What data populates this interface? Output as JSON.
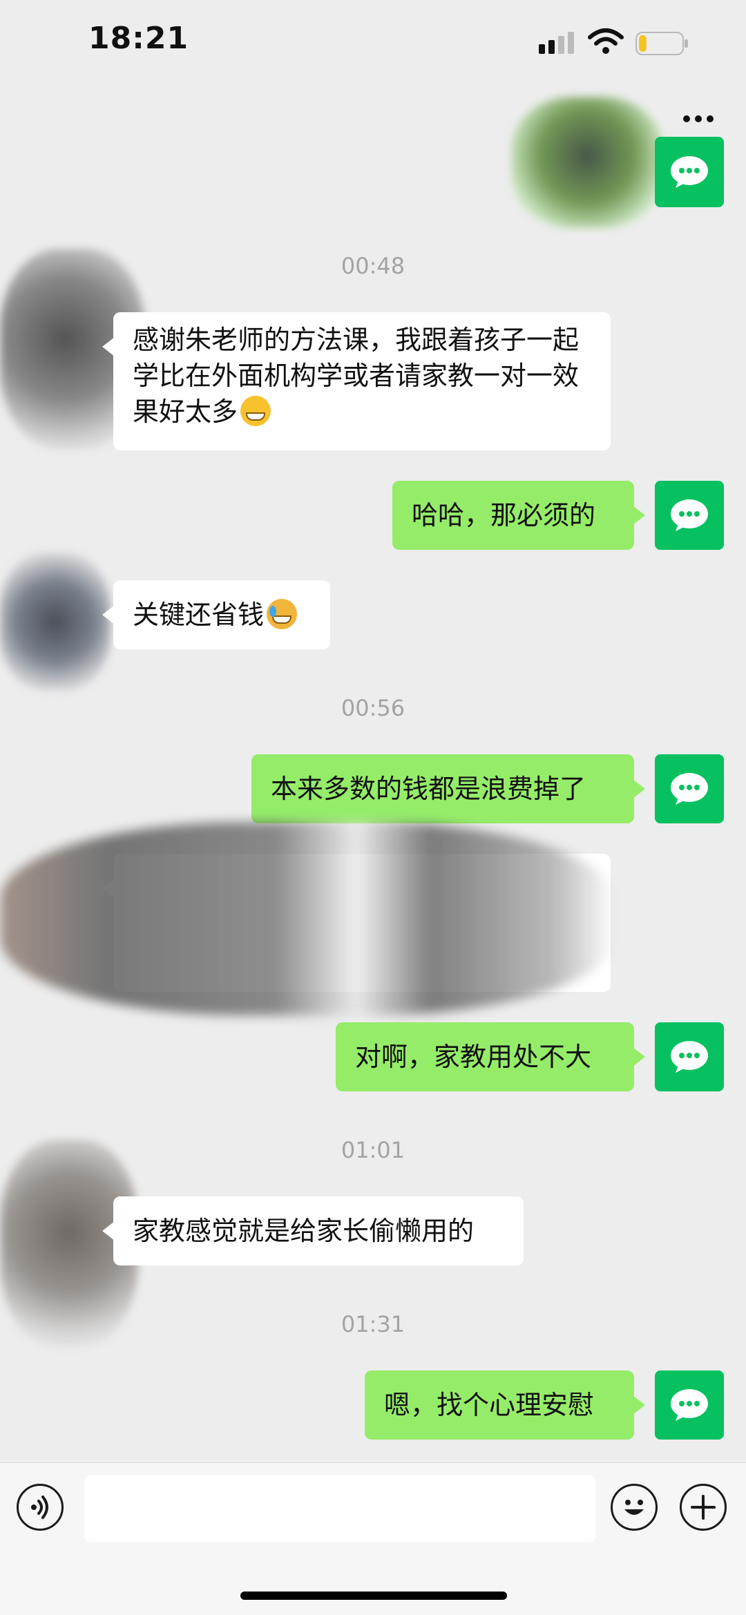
{
  "status_bar": {
    "time": "18:21",
    "battery_level": 0.18
  },
  "icons": {
    "signal": "cellular-signal-icon",
    "wifi": "wifi-icon",
    "battery": "battery-icon",
    "more": "more-icon",
    "avatar": "wechat-logo-icon",
    "voice": "voice-icon",
    "emoji": "emoji-icon",
    "plus": "plus-icon"
  },
  "colors": {
    "background": "#ededed",
    "sent_bubble": "#95ec69",
    "received_bubble": "#ffffff",
    "avatar": "#07c160",
    "timestamp": "#a3a3a3"
  },
  "timestamps": [
    "00:48",
    "00:56",
    "01:01",
    "01:31"
  ],
  "messages": [
    {
      "side": "left",
      "text": "感谢朱老师的方法课，我跟着孩子一起学比在外面机构学或者请家教一对一效果好太多",
      "emoji": "grinning-face"
    },
    {
      "side": "right",
      "text": "哈哈，那必须的"
    },
    {
      "side": "left",
      "text": "关键还省钱",
      "emoji": "face-with-tears"
    },
    {
      "side": "right",
      "text": "本来多数的钱都是浪费掉了"
    },
    {
      "side": "left",
      "text": "",
      "redacted": true
    },
    {
      "side": "right",
      "text": "对啊，家教用处不大"
    },
    {
      "side": "left",
      "text": "家教感觉就是给家长偷懒用的"
    },
    {
      "side": "right",
      "text": "嗯，找个心理安慰"
    }
  ],
  "input": {
    "value": "",
    "placeholder": ""
  }
}
